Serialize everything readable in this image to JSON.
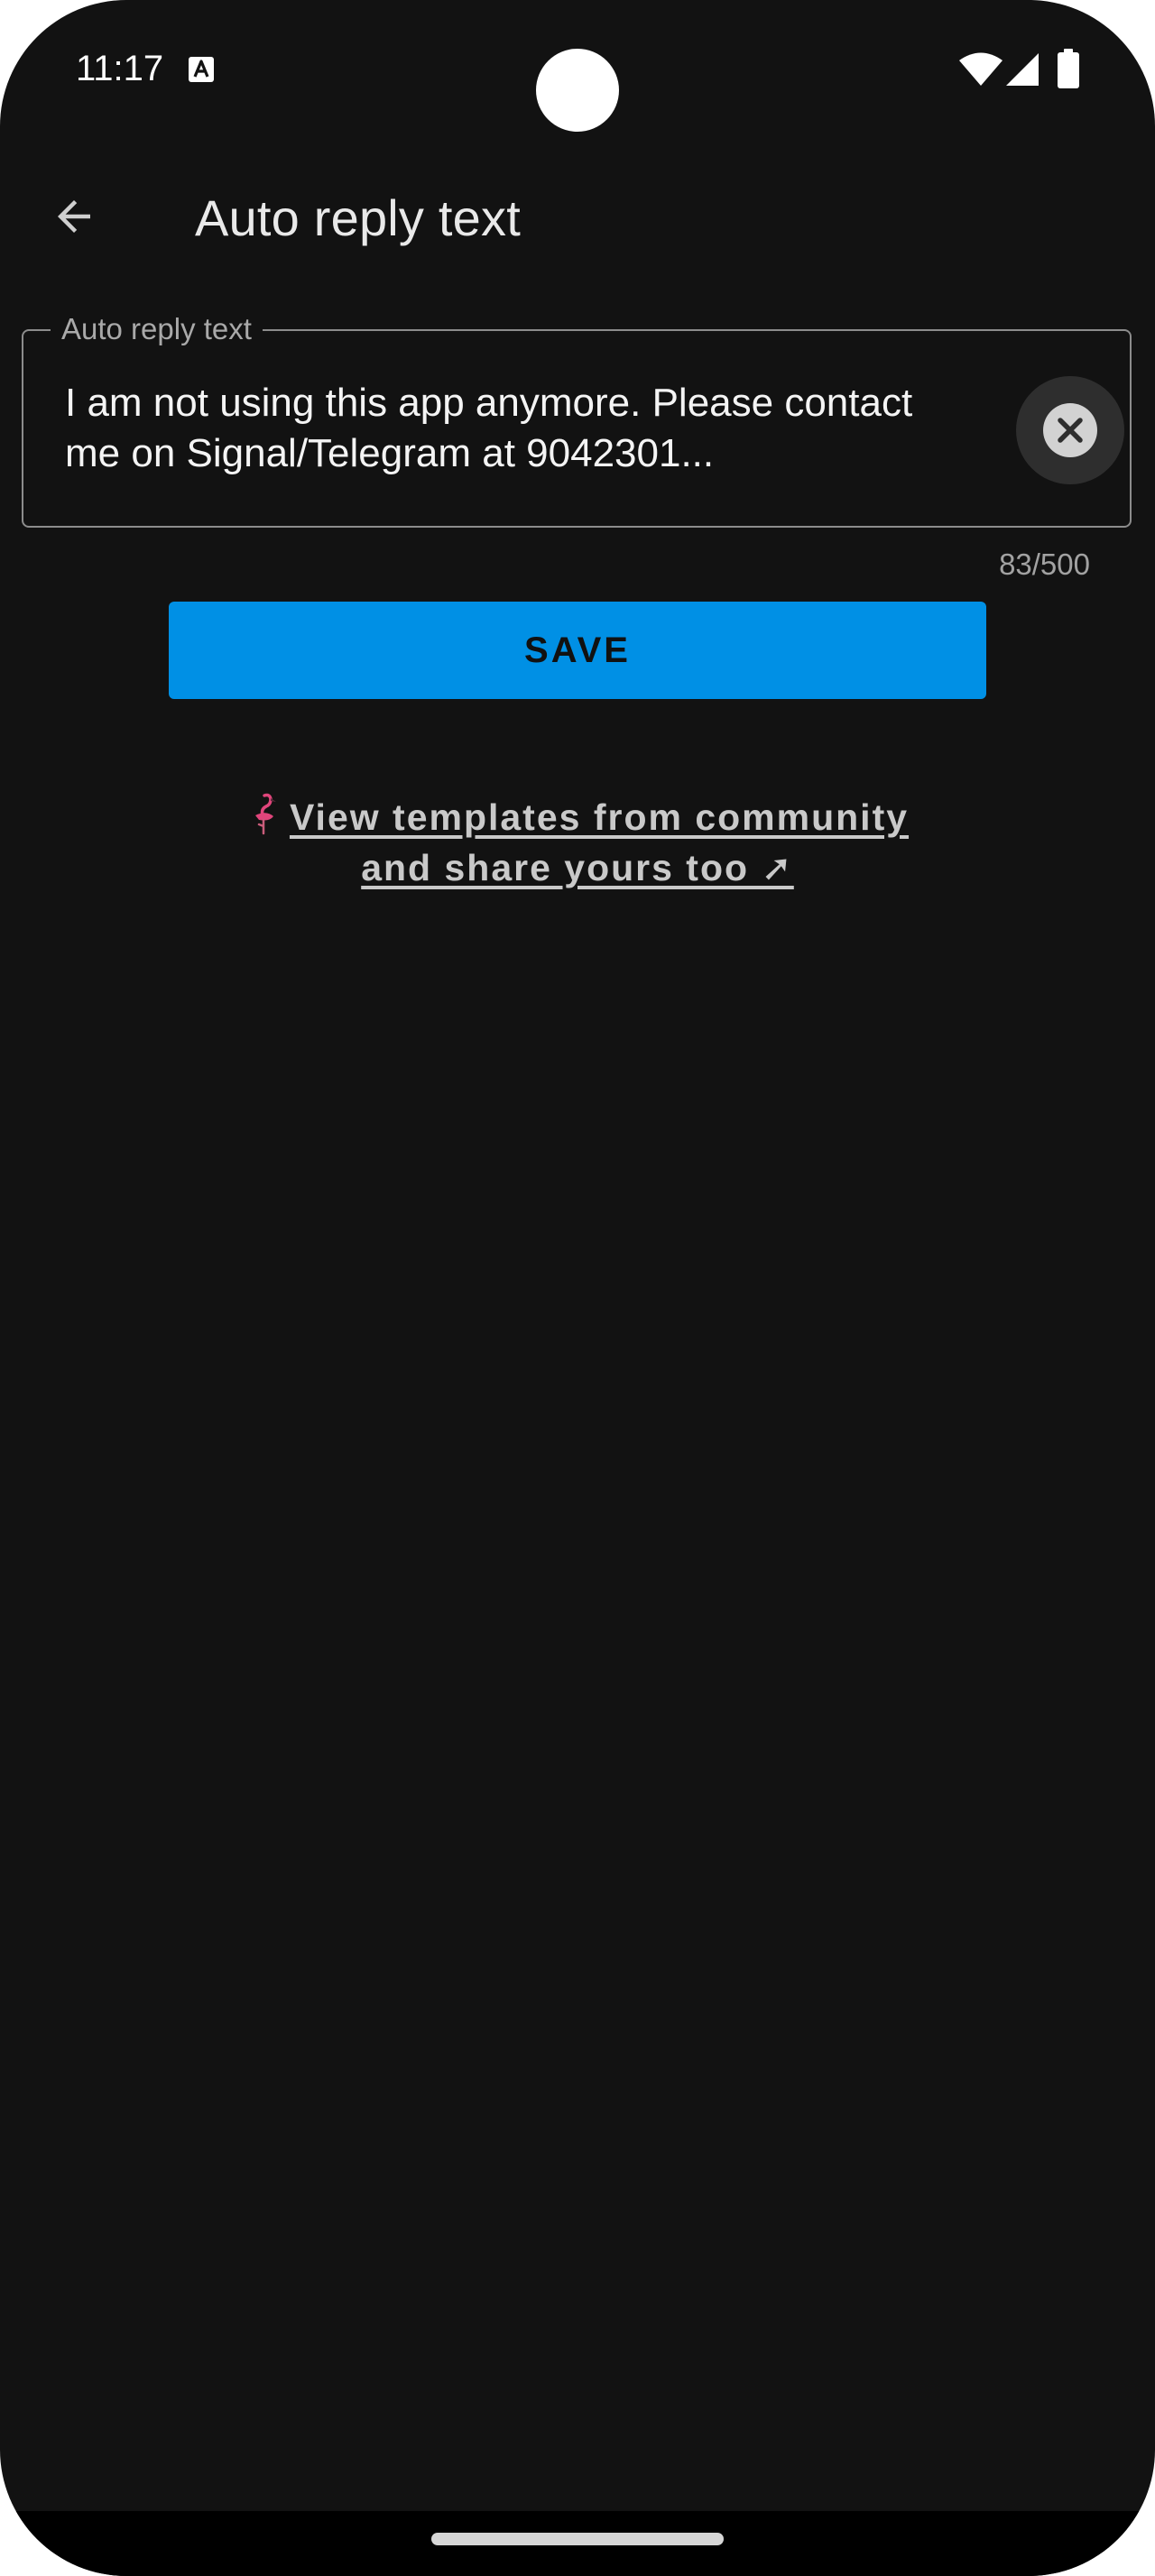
{
  "status_bar": {
    "time": "11:17",
    "icons": [
      "a-notification-icon",
      "wifi-icon",
      "signal-icon",
      "battery-icon"
    ]
  },
  "app_bar": {
    "back_icon": "arrow-back-icon",
    "title": "Auto reply text"
  },
  "reply_field": {
    "label": "Auto reply text",
    "value": "I am not using this app anymore. Please contact me on Signal/Telegram at 9042301...",
    "clear_icon": "clear-icon",
    "counter": "83/500"
  },
  "save_button": {
    "label": "SAVE"
  },
  "templates_link": {
    "icon": "flamingo-icon",
    "text": "View templates from community and share yours too ➚"
  },
  "colors": {
    "background": "#121212",
    "accent": "#0090e5",
    "text_primary": "#f4f4f4",
    "text_secondary": "#a9a9a9",
    "flamingo": "#e0457b"
  }
}
